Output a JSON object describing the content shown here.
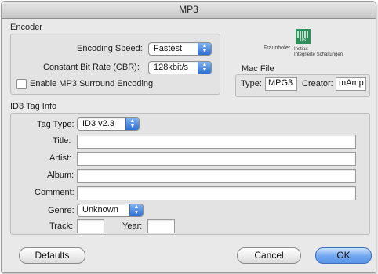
{
  "window": {
    "title": "MP3"
  },
  "encoder": {
    "section_label": "Encoder",
    "encoding_speed_label": "Encoding Speed:",
    "encoding_speed_value": "Fastest",
    "bit_rate_label": "Constant Bit Rate (CBR):",
    "bit_rate_value": "128kbit/s",
    "surround_label": "Enable MP3 Surround Encoding",
    "surround_checked": false
  },
  "logo": {
    "badge": "IIS",
    "name": "Fraunhofer",
    "line1": "Institut",
    "line2": "Integrierte Schaltungen"
  },
  "mac_file": {
    "section_label": "Mac File",
    "type_label": "Type:",
    "type_value": "MPG3",
    "creator_label": "Creator:",
    "creator_value": "mAmp"
  },
  "id3": {
    "section_label": "ID3 Tag Info",
    "tag_type_label": "Tag Type:",
    "tag_type_value": "ID3 v2.3",
    "title_label": "Title:",
    "title_value": "",
    "artist_label": "Artist:",
    "artist_value": "",
    "album_label": "Album:",
    "album_value": "",
    "comment_label": "Comment:",
    "comment_value": "",
    "genre_label": "Genre:",
    "genre_value": "Unknown",
    "track_label": "Track:",
    "track_value": "",
    "year_label": "Year:",
    "year_value": ""
  },
  "buttons": {
    "defaults": "Defaults",
    "cancel": "Cancel",
    "ok": "OK"
  },
  "colors": {
    "window_bg": "#e9e9e9",
    "accent": "#2c6fd3",
    "logo_green": "#2f8f5a"
  }
}
